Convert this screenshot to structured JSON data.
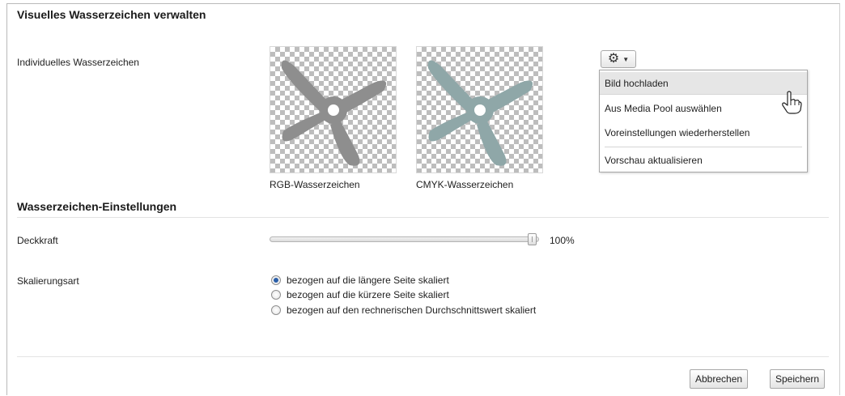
{
  "title": "Visuelles Wasserzeichen verwalten",
  "watermark_row": {
    "label": "Individuelles Wasserzeichen",
    "thumbnails": [
      {
        "caption": "RGB-Wasserzeichen",
        "color": "#8e8e8e"
      },
      {
        "caption": "CMYK-Wasserzeichen",
        "color": "#8fa7a8"
      }
    ],
    "gear_menu": {
      "icon": "gear-icon",
      "items": [
        {
          "label": "Bild hochladen"
        },
        {
          "label": "Aus Media Pool auswählen"
        },
        {
          "label": "Voreinstellungen wiederherstellen"
        },
        {
          "label": "Vorschau aktualisieren"
        }
      ]
    }
  },
  "settings": {
    "section_title": "Wasserzeichen-Einstellungen",
    "opacity": {
      "label": "Deckkraft",
      "value_text": "100%",
      "value": 100
    },
    "scaling": {
      "label": "Skalierungsart",
      "options": [
        {
          "label": "bezogen auf die längere Seite skaliert",
          "checked": true
        },
        {
          "label": "bezogen auf die kürzere Seite skaliert",
          "checked": false
        },
        {
          "label": "bezogen auf den rechnerischen Durchschnittswert skaliert",
          "checked": false
        }
      ]
    }
  },
  "footer": {
    "cancel_label": "Abbrechen",
    "save_label": "Speichern"
  },
  "colors": {
    "radio_checked": "#2a5ea8",
    "menu_hover": "#e6e6e6"
  }
}
